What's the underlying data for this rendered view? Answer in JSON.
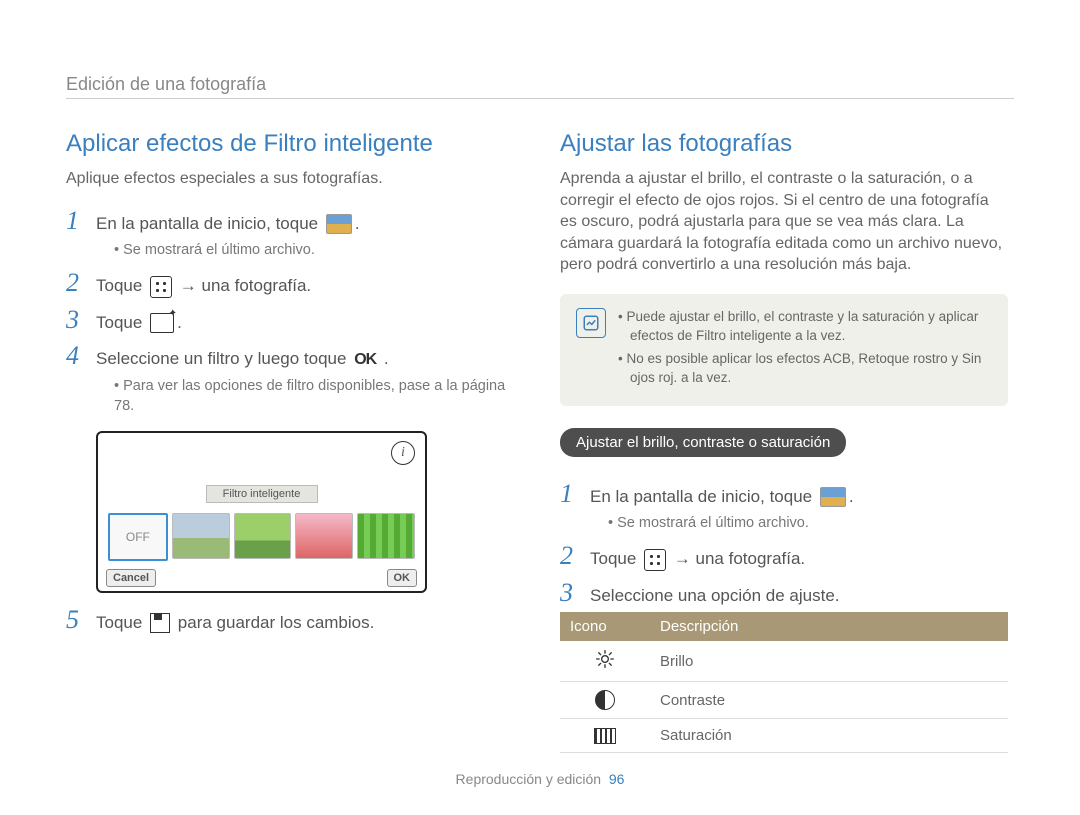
{
  "breadcrumb": "Edición de una fotografía",
  "footer": {
    "section": "Reproducción y edición",
    "page": "96"
  },
  "left": {
    "heading": "Aplicar efectos de Filtro inteligente",
    "intro": "Aplique efectos especiales a sus fotografías.",
    "step1": "En la pantalla de inicio, toque",
    "step1_after": ".",
    "step1_sub": "Se mostrará el último archivo.",
    "step2a": "Toque",
    "step2b": "→ una fotografía.",
    "step3a": "Toque",
    "step3_after": ".",
    "step4a": "Seleccione un filtro y luego toque",
    "step4_after": ".",
    "step4_sub": "Para ver las opciones de filtro disponibles, pase a la página 78.",
    "step5a": "Toque",
    "step5b": "para guardar los cambios.",
    "ok": "OK",
    "mock": {
      "label": "Filtro inteligente",
      "off": "OFF",
      "cancel": "Cancel",
      "ok": "OK"
    }
  },
  "right": {
    "heading": "Ajustar las fotografías",
    "intro": "Aprenda a ajustar el brillo, el contraste o la saturación, o a corregir el efecto de ojos rojos. Si el centro de una fotografía es oscuro, podrá ajustarla para que se vea más clara. La cámara guardará la fotografía editada como un archivo nuevo, pero podrá convertirlo a una resolución más baja.",
    "note1": "Puede ajustar el brillo, el contraste y la saturación y aplicar efectos de Filtro inteligente a la vez.",
    "note2": "No es posible aplicar los efectos ACB, Retoque rostro y Sin ojos roj. a la vez.",
    "pill": "Ajustar el brillo, contraste o saturación",
    "step1": "En la pantalla de inicio, toque",
    "step1_after": ".",
    "step1_sub": "Se mostrará el último archivo.",
    "step2a": "Toque",
    "step2b": "→ una fotografía.",
    "step3": "Seleccione una opción de ajuste.",
    "table": {
      "h1": "Icono",
      "h2": "Descripción",
      "r1": "Brillo",
      "r2": "Contraste",
      "r3": "Saturación"
    }
  }
}
